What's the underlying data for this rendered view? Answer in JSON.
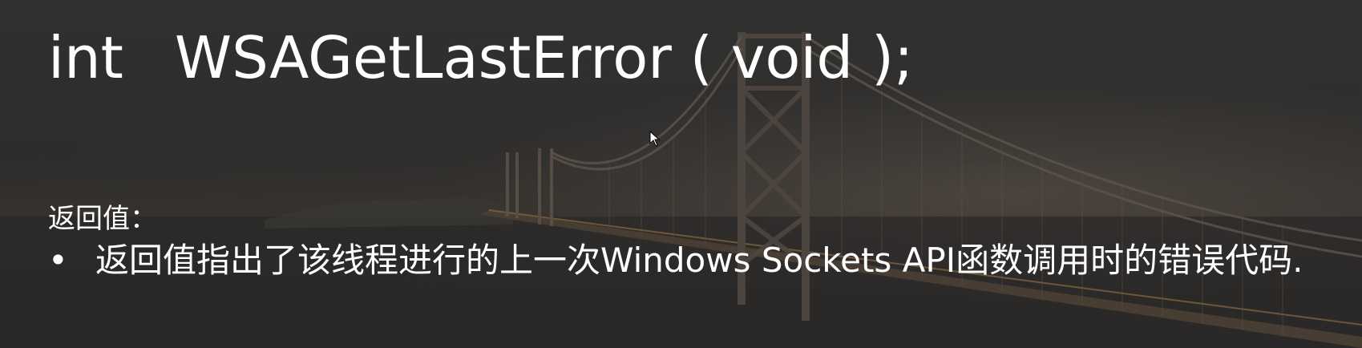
{
  "slide": {
    "title_return_type": "int",
    "title_signature": "WSAGetLastError ( void );",
    "section_label": "返回值：",
    "bullets": [
      {
        "marker": "•",
        "text": "返回值指出了该线程进行的上一次Windows Sockets API函数调用时的错误代码."
      }
    ]
  },
  "background": {
    "image": "bridge-photo",
    "tint": "#2e2d2c",
    "light_color": "#8a7560"
  },
  "cursor": {
    "icon": "arrow-cursor-icon"
  }
}
